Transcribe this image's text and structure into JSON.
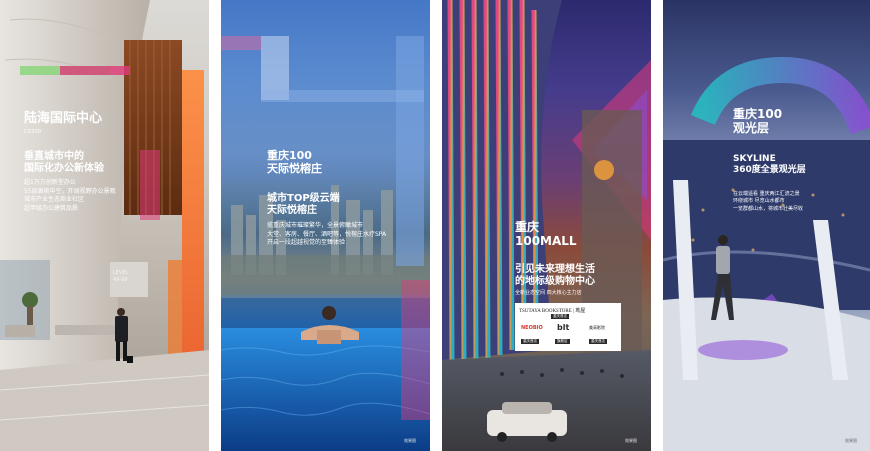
{
  "panels": [
    {
      "title": "陆海国际中心",
      "subtitle": "CQ100",
      "headline": [
        "垂直城市中的",
        "国际化办公新体验"
      ],
      "bullets": [
        "超1万方创新型办公",
        "55层高挑中空，开阔视野办公景观",
        "城市产业生态商业社区",
        "超甲级办公建筑品质"
      ],
      "sign": [
        "LEVEL",
        "49-99"
      ]
    },
    {
      "title": [
        "重庆100",
        "天际悦榕庄"
      ],
      "headline": [
        "城市TOP级云端",
        "天际悦榕庄"
      ],
      "body": [
        "揽重庆城市璀璨繁华，全景俯瞰城市",
        "大堂、客房、餐厅、酒吧等，悦榕庄水疗SPA",
        "开启一段超越视觉的至臻体验"
      ],
      "foot": "效果图"
    },
    {
      "title": [
        "重庆",
        "100MALL"
      ],
      "headline": [
        "引见未来理想生活",
        "的地标级购物中心"
      ],
      "tagline": "全新业态空间 四大核心主力店",
      "store1": "TSUTAYA BOOKSTORE | 茑屋",
      "store1_tag": "重庆首店",
      "brands": [
        "NEOBIO",
        "blt",
        "美高影院"
      ],
      "brand_tags": [
        "重庆首店",
        "旗舰店",
        "重庆首店"
      ],
      "foot": "效果图"
    },
    {
      "title": [
        "重庆100",
        "观光层"
      ],
      "headline": [
        "SKYLINE",
        "360度全景观光层"
      ],
      "body": [
        "在云端遥看 重庆两江汇流之景",
        "环绕城市 尽览山水都市",
        "一览群都山水，将城市壮美尽收"
      ],
      "foot": "效果图"
    }
  ],
  "colors": {
    "accent_orange": "#f27c2a",
    "accent_magenta": "#e0397a",
    "accent_blue": "#2a6fd6",
    "accent_teal": "#24c0c4",
    "accent_purple": "#8a4fd6"
  }
}
